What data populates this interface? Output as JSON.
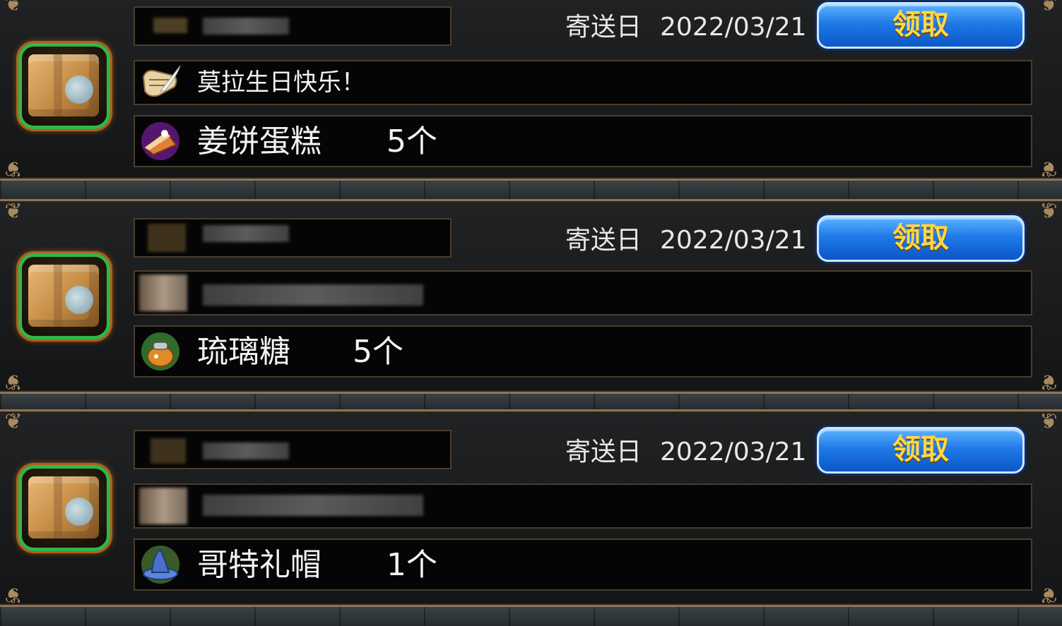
{
  "date_label": "寄送日",
  "claim_label": "领取",
  "mails": [
    {
      "date": "2022/03/21",
      "message": "莫拉生日快乐！",
      "message_icon": "scroll-quill-icon",
      "item": {
        "name": "姜饼蛋糕",
        "quantity": "5个",
        "icon": "cake-slice-icon"
      }
    },
    {
      "date": "2022/03/21",
      "message": "",
      "message_icon": "blurred-icon",
      "item": {
        "name": "琉璃糖",
        "quantity": "5个",
        "icon": "candy-pot-icon"
      }
    },
    {
      "date": "2022/03/21",
      "message": "",
      "message_icon": "blurred-icon",
      "item": {
        "name": "哥特礼帽",
        "quantity": "1个",
        "icon": "gothic-hat-icon"
      }
    }
  ],
  "colors": {
    "frame_gold": "#8d7553",
    "claim_blue": "#1f7ae8",
    "claim_text": "#ffd64a",
    "package_ring": "#2fb84a"
  }
}
